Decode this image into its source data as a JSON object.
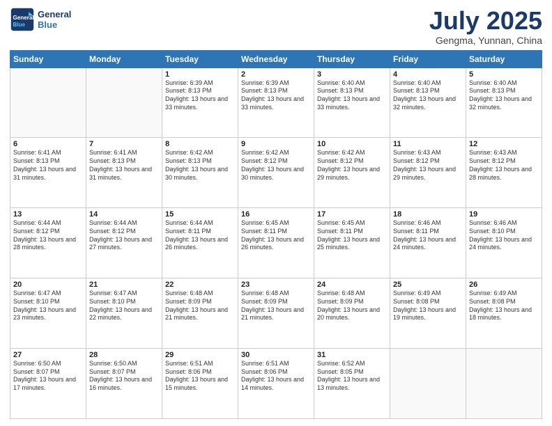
{
  "logo": {
    "line1": "General",
    "line2": "Blue"
  },
  "title": "July 2025",
  "subtitle": "Gengma, Yunnan, China",
  "days_of_week": [
    "Sunday",
    "Monday",
    "Tuesday",
    "Wednesday",
    "Thursday",
    "Friday",
    "Saturday"
  ],
  "weeks": [
    [
      {
        "day": "",
        "info": ""
      },
      {
        "day": "",
        "info": ""
      },
      {
        "day": "1",
        "info": "Sunrise: 6:39 AM\nSunset: 8:13 PM\nDaylight: 13 hours and 33 minutes."
      },
      {
        "day": "2",
        "info": "Sunrise: 6:39 AM\nSunset: 8:13 PM\nDaylight: 13 hours and 33 minutes."
      },
      {
        "day": "3",
        "info": "Sunrise: 6:40 AM\nSunset: 8:13 PM\nDaylight: 13 hours and 33 minutes."
      },
      {
        "day": "4",
        "info": "Sunrise: 6:40 AM\nSunset: 8:13 PM\nDaylight: 13 hours and 32 minutes."
      },
      {
        "day": "5",
        "info": "Sunrise: 6:40 AM\nSunset: 8:13 PM\nDaylight: 13 hours and 32 minutes."
      }
    ],
    [
      {
        "day": "6",
        "info": "Sunrise: 6:41 AM\nSunset: 8:13 PM\nDaylight: 13 hours and 31 minutes."
      },
      {
        "day": "7",
        "info": "Sunrise: 6:41 AM\nSunset: 8:13 PM\nDaylight: 13 hours and 31 minutes."
      },
      {
        "day": "8",
        "info": "Sunrise: 6:42 AM\nSunset: 8:13 PM\nDaylight: 13 hours and 30 minutes."
      },
      {
        "day": "9",
        "info": "Sunrise: 6:42 AM\nSunset: 8:12 PM\nDaylight: 13 hours and 30 minutes."
      },
      {
        "day": "10",
        "info": "Sunrise: 6:42 AM\nSunset: 8:12 PM\nDaylight: 13 hours and 29 minutes."
      },
      {
        "day": "11",
        "info": "Sunrise: 6:43 AM\nSunset: 8:12 PM\nDaylight: 13 hours and 29 minutes."
      },
      {
        "day": "12",
        "info": "Sunrise: 6:43 AM\nSunset: 8:12 PM\nDaylight: 13 hours and 28 minutes."
      }
    ],
    [
      {
        "day": "13",
        "info": "Sunrise: 6:44 AM\nSunset: 8:12 PM\nDaylight: 13 hours and 28 minutes."
      },
      {
        "day": "14",
        "info": "Sunrise: 6:44 AM\nSunset: 8:12 PM\nDaylight: 13 hours and 27 minutes."
      },
      {
        "day": "15",
        "info": "Sunrise: 6:44 AM\nSunset: 8:11 PM\nDaylight: 13 hours and 26 minutes."
      },
      {
        "day": "16",
        "info": "Sunrise: 6:45 AM\nSunset: 8:11 PM\nDaylight: 13 hours and 26 minutes."
      },
      {
        "day": "17",
        "info": "Sunrise: 6:45 AM\nSunset: 8:11 PM\nDaylight: 13 hours and 25 minutes."
      },
      {
        "day": "18",
        "info": "Sunrise: 6:46 AM\nSunset: 8:11 PM\nDaylight: 13 hours and 24 minutes."
      },
      {
        "day": "19",
        "info": "Sunrise: 6:46 AM\nSunset: 8:10 PM\nDaylight: 13 hours and 24 minutes."
      }
    ],
    [
      {
        "day": "20",
        "info": "Sunrise: 6:47 AM\nSunset: 8:10 PM\nDaylight: 13 hours and 23 minutes."
      },
      {
        "day": "21",
        "info": "Sunrise: 6:47 AM\nSunset: 8:10 PM\nDaylight: 13 hours and 22 minutes."
      },
      {
        "day": "22",
        "info": "Sunrise: 6:48 AM\nSunset: 8:09 PM\nDaylight: 13 hours and 21 minutes."
      },
      {
        "day": "23",
        "info": "Sunrise: 6:48 AM\nSunset: 8:09 PM\nDaylight: 13 hours and 21 minutes."
      },
      {
        "day": "24",
        "info": "Sunrise: 6:48 AM\nSunset: 8:09 PM\nDaylight: 13 hours and 20 minutes."
      },
      {
        "day": "25",
        "info": "Sunrise: 6:49 AM\nSunset: 8:08 PM\nDaylight: 13 hours and 19 minutes."
      },
      {
        "day": "26",
        "info": "Sunrise: 6:49 AM\nSunset: 8:08 PM\nDaylight: 13 hours and 18 minutes."
      }
    ],
    [
      {
        "day": "27",
        "info": "Sunrise: 6:50 AM\nSunset: 8:07 PM\nDaylight: 13 hours and 17 minutes."
      },
      {
        "day": "28",
        "info": "Sunrise: 6:50 AM\nSunset: 8:07 PM\nDaylight: 13 hours and 16 minutes."
      },
      {
        "day": "29",
        "info": "Sunrise: 6:51 AM\nSunset: 8:06 PM\nDaylight: 13 hours and 15 minutes."
      },
      {
        "day": "30",
        "info": "Sunrise: 6:51 AM\nSunset: 8:06 PM\nDaylight: 13 hours and 14 minutes."
      },
      {
        "day": "31",
        "info": "Sunrise: 6:52 AM\nSunset: 8:05 PM\nDaylight: 13 hours and 13 minutes."
      },
      {
        "day": "",
        "info": ""
      },
      {
        "day": "",
        "info": ""
      }
    ]
  ]
}
